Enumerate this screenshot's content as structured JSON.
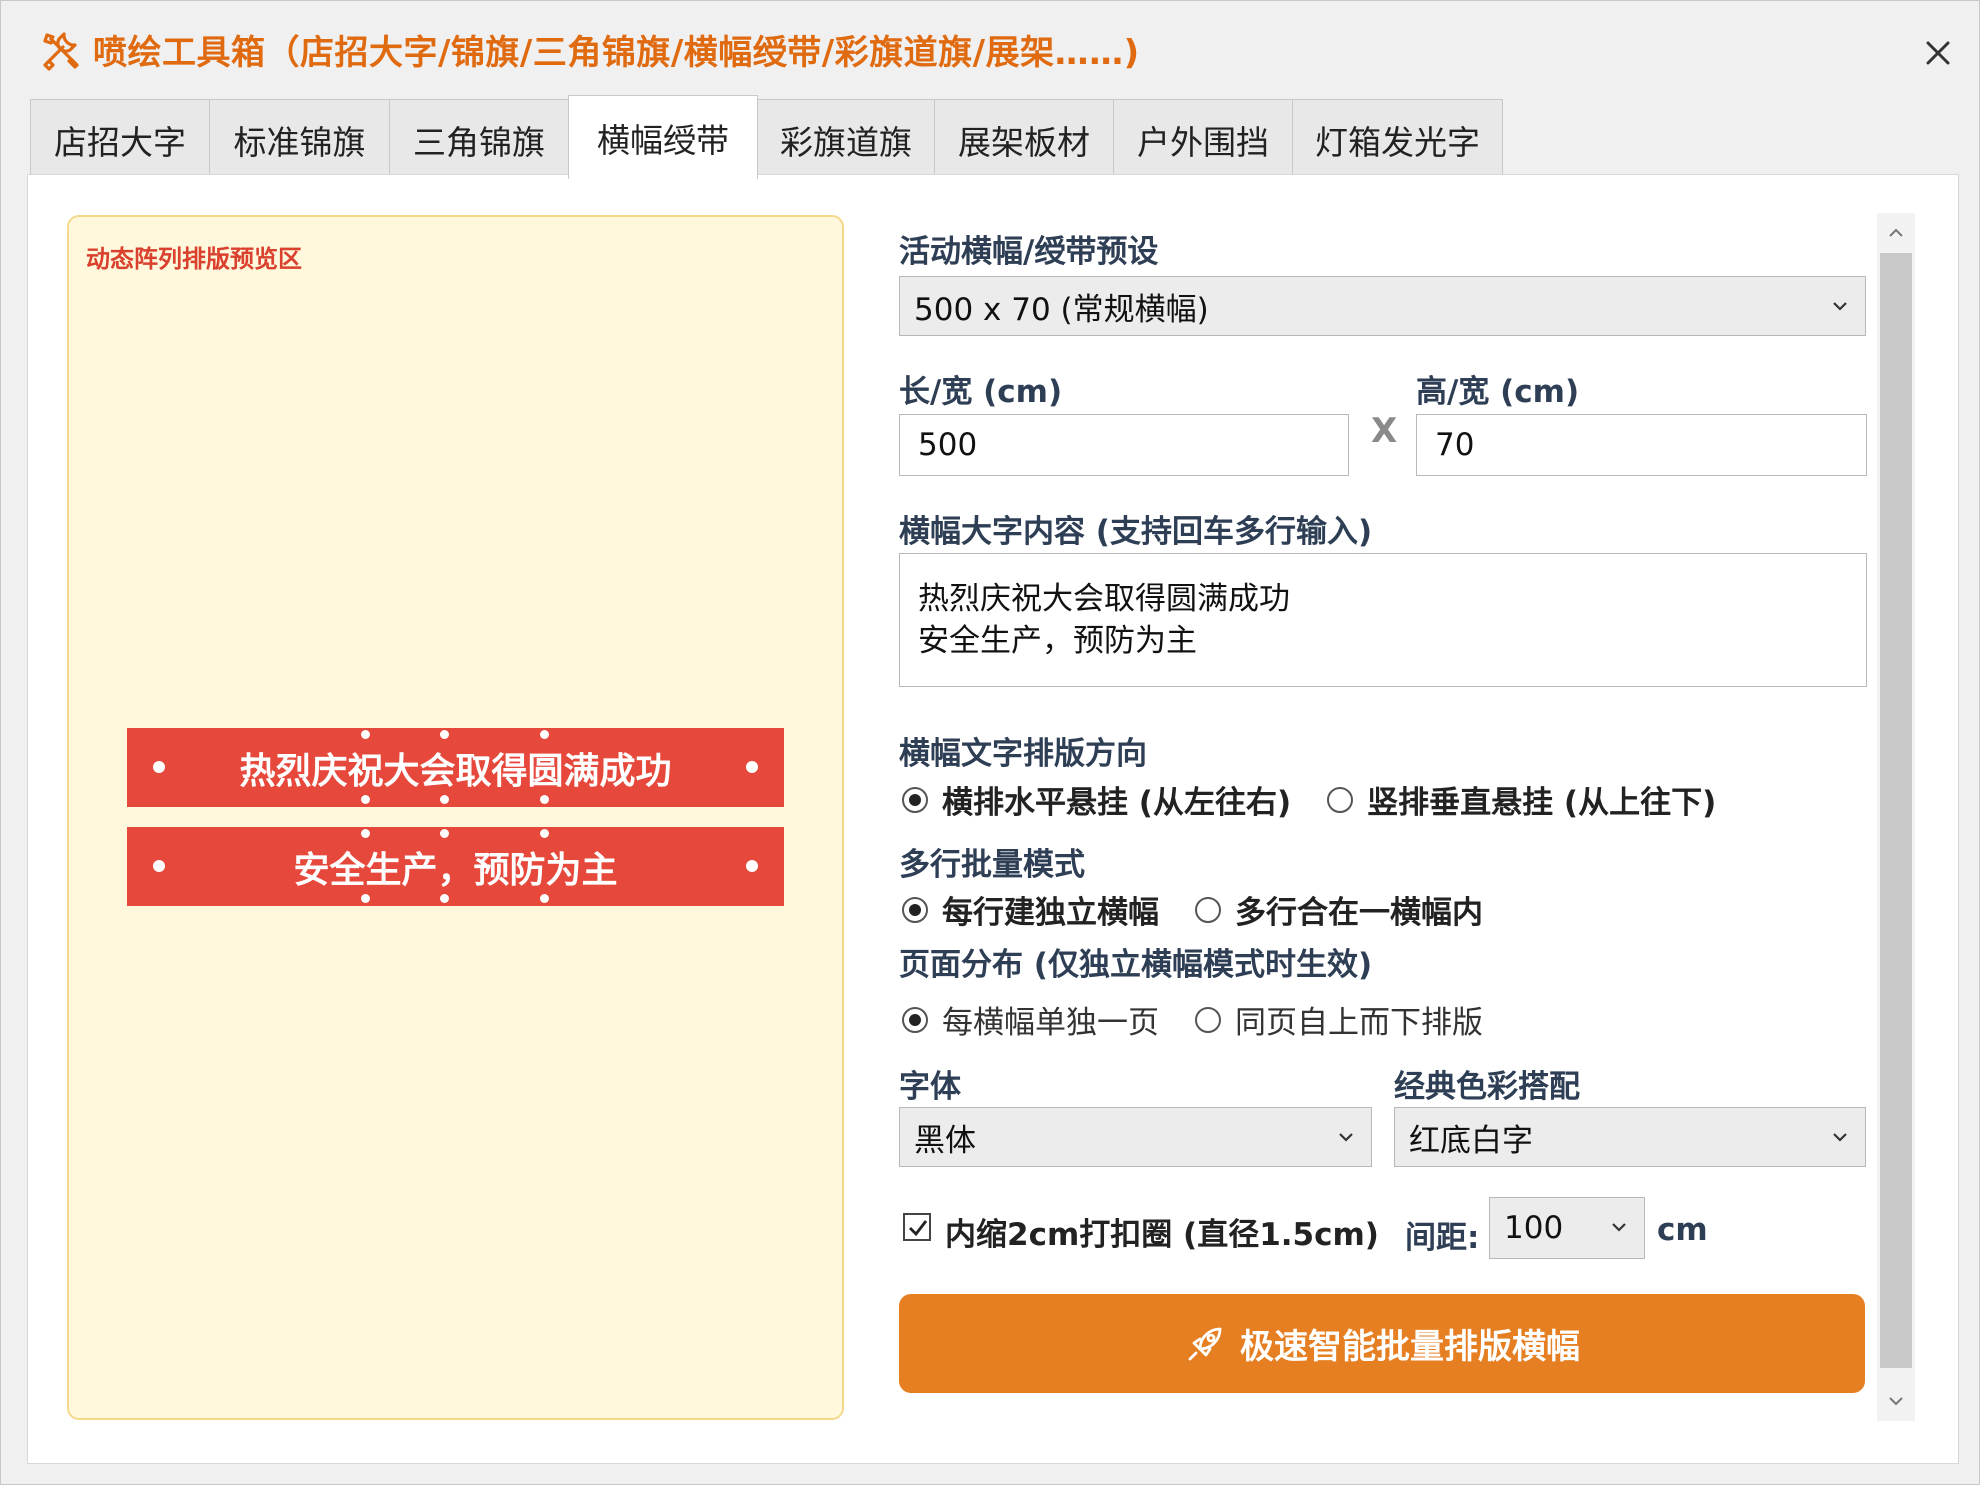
{
  "window": {
    "title": "喷绘工具箱（店招大字/锦旗/三角锦旗/横幅绶带/彩旗道旗/展架……)",
    "icon": "tools-icon",
    "close_icon": "close-icon"
  },
  "tabs": [
    {
      "label": "店招大字",
      "active": false
    },
    {
      "label": "标准锦旗",
      "active": false
    },
    {
      "label": "三角锦旗",
      "active": false
    },
    {
      "label": "横幅绶带",
      "active": true
    },
    {
      "label": "彩旗道旗",
      "active": false
    },
    {
      "label": "展架板材",
      "active": false
    },
    {
      "label": "户外围挡",
      "active": false
    },
    {
      "label": "灯箱发光字",
      "active": false
    }
  ],
  "preview": {
    "label": "动态阵列排版预览区",
    "banners": [
      "热烈庆祝大会取得圆满成功",
      "安全生产，预防为主"
    ],
    "banner_color": "#e6493c",
    "text_color": "#ffffff"
  },
  "form": {
    "preset_label": "活动横幅/绶带预设",
    "preset_value": "500 x 70 (常规横幅)",
    "length_label": "长/宽 (cm)",
    "length_value": "500",
    "times": "X",
    "height_label": "高/宽 (cm)",
    "height_value": "70",
    "content_label": "横幅大字内容 (支持回车多行输入)",
    "content_lines": [
      "热烈庆祝大会取得圆满成功",
      "安全生产，预防为主"
    ],
    "direction_label": "横幅文字排版方向",
    "direction_options": [
      "横排水平悬挂 (从左往右)",
      "竖排垂直悬挂 (从上往下)"
    ],
    "direction_selected": 0,
    "multiline_label": "多行批量模式",
    "multiline_options": [
      "每行建独立横幅",
      "多行合在一横幅内"
    ],
    "multiline_selected": 0,
    "page_label": "页面分布 (仅独立横幅模式时生效)",
    "page_options": [
      "每横幅单独一页",
      "同页自上而下排版"
    ],
    "page_selected": 0,
    "font_label": "字体",
    "font_value": "黑体",
    "color_label": "经典色彩搭配",
    "color_value": "红底白字",
    "grommet_label": "内缩2cm打扣圈 (直径1.5cm)",
    "grommet_checked": true,
    "spacing_label": "间距:",
    "spacing_value": "100",
    "spacing_unit": "cm",
    "submit_label": "极速智能批量排版横幅",
    "submit_icon": "rocket-icon",
    "submit_color": "#e67e22"
  }
}
